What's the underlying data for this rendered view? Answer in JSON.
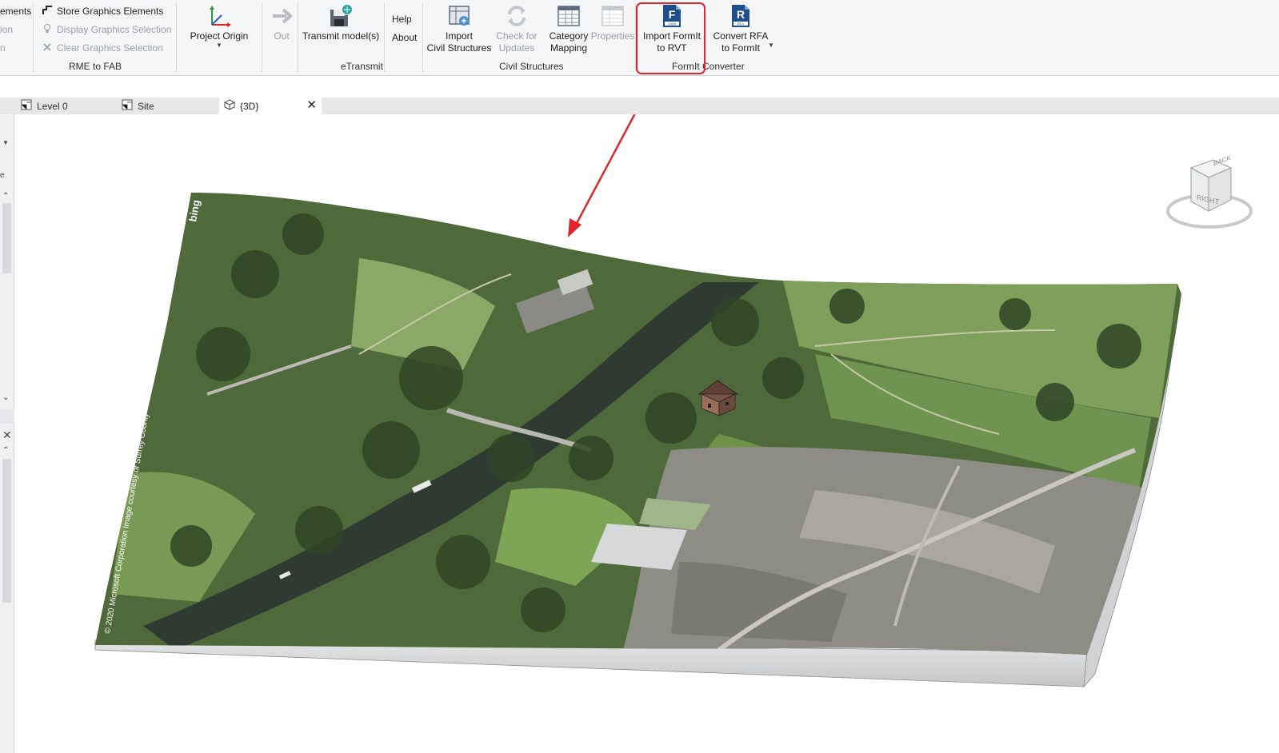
{
  "ribbon": {
    "rme_panel": {
      "cut_label": "ements",
      "cut_label2": "ion",
      "cut_label3": "n",
      "store_graphics": "Store Graphics Elements",
      "display_graphics": "Display Graphics Selection",
      "clear_graphics": "Clear Graphics Selection",
      "title": "RME to FAB"
    },
    "project_origin": {
      "label": "Project Origin"
    },
    "out": {
      "label": "Out"
    },
    "etransmit": {
      "transmit_label": "Transmit model(s)",
      "title": "eTransmit"
    },
    "help": {
      "help_label": "Help",
      "about_label": "About"
    },
    "civil": {
      "import_label": "Import\nCivil Structures",
      "check_label": "Check for\nUpdates",
      "category_label": "Category\nMapping",
      "properties_label": "Properties",
      "title": "Civil Structures"
    },
    "formit": {
      "import_label": "Import FormIt\nto RVT",
      "convert_label": "Convert RFA\nto FormIt",
      "title": "FormIt Converter",
      "axm_badge": "AXM",
      "rfa_badge": "RFA"
    }
  },
  "tabs": [
    {
      "label": "Level 0"
    },
    {
      "label": "Site"
    },
    {
      "label": "{3D}"
    }
  ],
  "viewcube": {
    "right": "RIGHT",
    "back": "BACK"
  },
  "map": {
    "bing_label": "bing",
    "copyright": "© 2020 Microsoft Corporation Image courtesy of Surrey County"
  },
  "colors": {
    "highlight": "#e0242a",
    "arrow": "#e0242a",
    "ribbon_bg": "#f5f6f7"
  }
}
